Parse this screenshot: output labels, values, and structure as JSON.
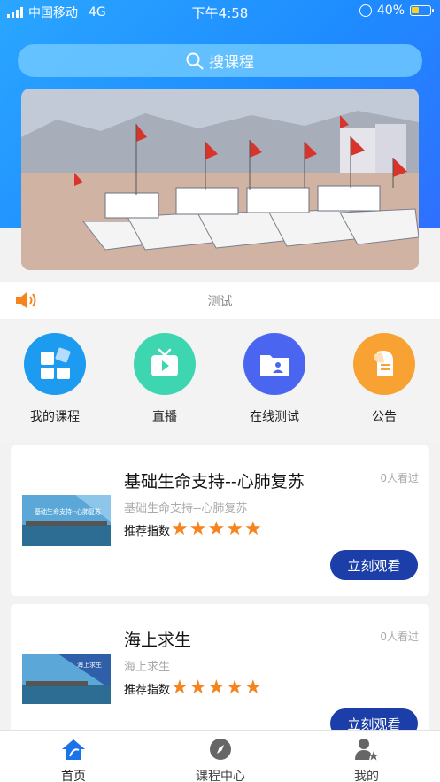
{
  "status_bar": {
    "carrier": "中国移动",
    "network": "4G",
    "time": "下午4:58",
    "battery": "40%",
    "battery_level": 0.4
  },
  "search": {
    "label": "搜课程"
  },
  "banner": {
    "image_name": "harbor-fishing-boats"
  },
  "notice": {
    "text": "测试"
  },
  "quick_nav": [
    {
      "label": "我的课程",
      "icon": "my-courses-icon",
      "color": "#1d9bf0"
    },
    {
      "label": "直播",
      "icon": "live-tv-icon",
      "color": "#3dd6b0"
    },
    {
      "label": "在线测试",
      "icon": "online-test-icon",
      "color": "#4a66f0"
    },
    {
      "label": "公告",
      "icon": "announcement-icon",
      "color": "#f7a233"
    }
  ],
  "courses": [
    {
      "title": "基础生命支持--心肺复苏",
      "subtitle": "基础生命支持--心肺复苏",
      "thumb_caption": "基础生命支持--心肺复苏",
      "views": "0人看过",
      "rating_label": "推荐指数",
      "stars": 5,
      "button": "立刻观看"
    },
    {
      "title": "海上求生",
      "subtitle": "海上求生",
      "thumb_caption": "海上求生",
      "views": "0人看过",
      "rating_label": "推荐指数",
      "stars": 5,
      "button": "立刻观看"
    }
  ],
  "tab_bar": [
    {
      "label": "首页",
      "icon": "home-icon",
      "active": true
    },
    {
      "label": "课程中心",
      "icon": "compass-icon",
      "active": false
    },
    {
      "label": "我的",
      "icon": "profile-icon",
      "active": false
    }
  ],
  "colors": {
    "header_blue": "#1e8cff",
    "button_blue": "#1b3ea8",
    "star_orange": "#f5841f",
    "active_tab": "#1a73e8"
  }
}
